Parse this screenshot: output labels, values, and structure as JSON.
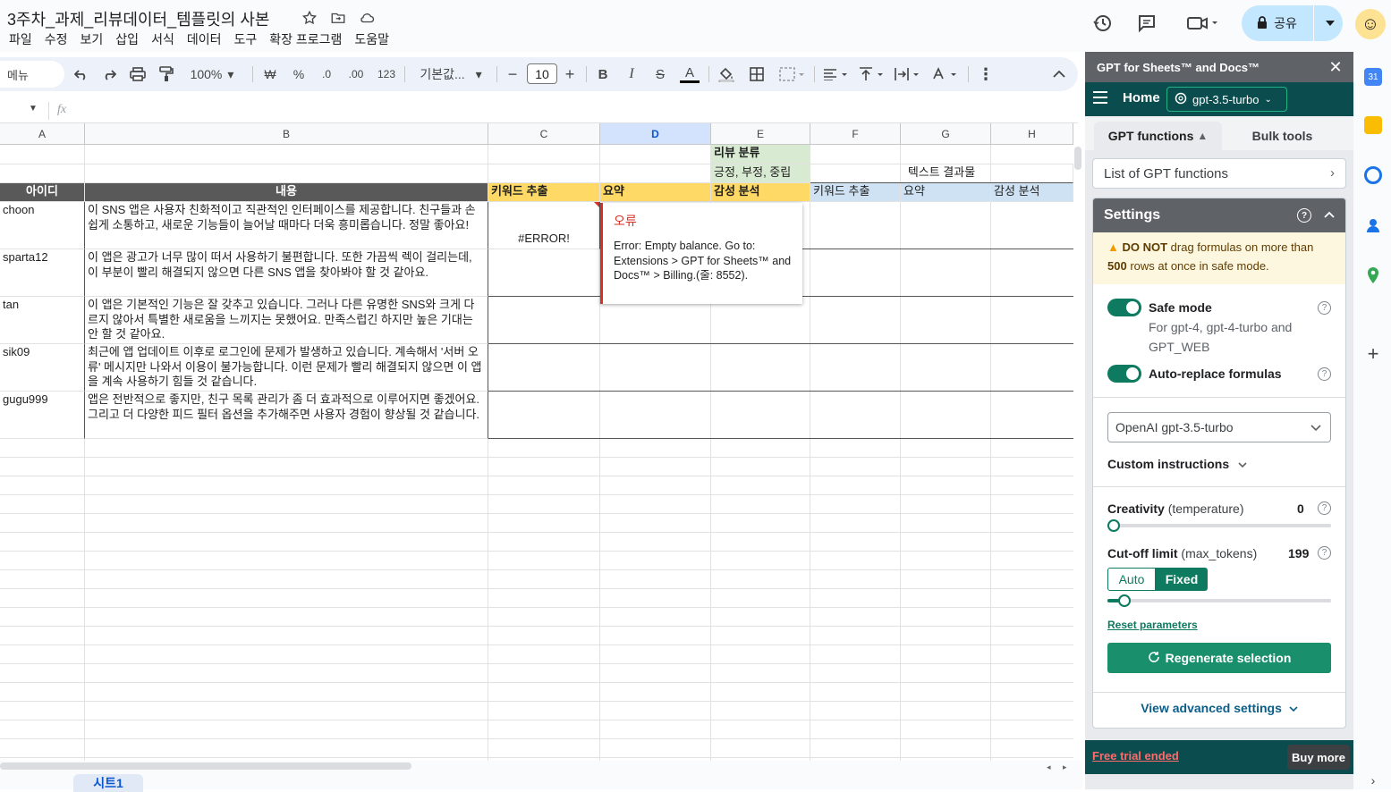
{
  "doc": {
    "title": "3주차_과제_리뷰데이터_템플릿의 사본",
    "menu": [
      "파일",
      "수정",
      "보기",
      "삽입",
      "서식",
      "데이터",
      "도구",
      "확장 프로그램",
      "도움말"
    ],
    "share_label": "공유"
  },
  "toolbar": {
    "menu_search": "메뉴",
    "zoom": "100%",
    "currency": "₩",
    "percent": "%",
    "dec_decrease": ".0",
    "dec_increase": ".00",
    "number_format": "123",
    "font": "기본값...",
    "font_size": "10",
    "bold": "B",
    "italic": "I",
    "strike": "S",
    "text_color": "A",
    "fx": "fx"
  },
  "sheet": {
    "columns": [
      "A",
      "B",
      "C",
      "D",
      "E",
      "F",
      "G",
      "H"
    ],
    "selected_column": "D",
    "group_header": "리뷰 분류",
    "group_sub": "긍정, 부정, 중립",
    "result_header": "텍스트 결과물",
    "headers": {
      "a": "아이디",
      "b": "내용",
      "c": "키워드 추출",
      "d": "요약",
      "e": "감성 분석",
      "f": "키워드 추출",
      "g": "요약",
      "h": "감성 분석"
    },
    "rows": [
      {
        "id": "choon",
        "content": "이 SNS 앱은 사용자 친화적이고 직관적인 인터페이스를 제공합니다. 친구들과 손쉽게 소통하고, 새로운 기능들이 늘어날 때마다 더욱 흥미롭습니다. 정말 좋아요!",
        "c": "#ERROR!"
      },
      {
        "id": "sparta12",
        "content": "이 앱은 광고가 너무 많이 떠서 사용하기 불편합니다. 또한 가끔씩 렉이 걸리는데, 이 부분이 빨리 해결되지 않으면 다른 SNS 앱을 찾아봐야 할 것 같아요.",
        "c": ""
      },
      {
        "id": "tan",
        "content": "이 앱은 기본적인 기능은 잘 갖추고 있습니다. 그러나 다른 유명한 SNS와 크게 다르지 않아서 특별한 새로움을 느끼지는 못했어요. 만족스럽긴 하지만 높은 기대는 안 할 것 같아요.",
        "c": ""
      },
      {
        "id": "sik09",
        "content": "최근에 앱 업데이트 이후로 로그인에 문제가 발생하고 있습니다. 계속해서 '서버 오류' 메시지만 나와서 이용이 불가능합니다. 이런 문제가 빨리 해결되지 않으면 이 앱을 계속 사용하기 힘들 것 같습니다.",
        "c": ""
      },
      {
        "id": "gugu999",
        "content": "앱은 전반적으로 좋지만, 친구 목록 관리가 좀 더 효과적으로 이루어지면 좋겠어요. 그리고 더 다양한 피드 필터 옵션을 추가해주면 사용자 경험이 향상될 것 같습니다.",
        "c": ""
      }
    ],
    "error_popup": {
      "title": "오류",
      "message": "Error: Empty balance. Go to: Extensions > GPT for Sheets™ and Docs™ > Billing.(줄: 8552)."
    },
    "sheet_tab": "시트1"
  },
  "panel": {
    "title": "GPT for Sheets™ and Docs™",
    "home": "Home",
    "model": "gpt-3.5-turbo",
    "tab_functions": "GPT functions",
    "tab_bulk": "Bulk tools",
    "list_functions": "List of GPT functions",
    "settings_title": "Settings",
    "warning_bold1": "DO NOT",
    "warning_text1": " drag formulas on more than",
    "warning_bold2": "500",
    "warning_text2": " rows at once in safe mode.",
    "safe_mode": "Safe mode",
    "safe_mode_sub": "For gpt-4, gpt-4-turbo and GPT_WEB",
    "auto_replace": "Auto-replace formulas",
    "model_select": "OpenAI gpt-3.5-turbo",
    "custom_instructions": "Custom instructions",
    "creativity_label": "Creativity",
    "creativity_param": " (temperature)",
    "creativity_value": "0",
    "cutoff_label": "Cut-off limit",
    "cutoff_param": " (max_tokens)",
    "cutoff_value": "199",
    "auto": "Auto",
    "fixed": "Fixed",
    "reset": "Reset parameters",
    "regenerate": "Regenerate selection",
    "view_advanced": "View advanced settings",
    "free_trial": "Free trial ended",
    "buy_more": "Buy more"
  },
  "colors": {
    "accent_green": "#0e7a5f",
    "nav_dark": "#0b4d4f",
    "header_yellow": "#ffd966",
    "header_dark": "#595959",
    "error_red": "#d93025"
  }
}
